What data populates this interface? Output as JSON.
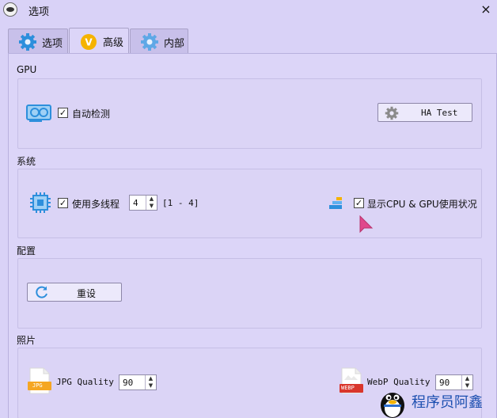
{
  "window": {
    "title": "选项",
    "close_glyph": "×"
  },
  "tabs": [
    {
      "label": "选项",
      "icon": "gear-icon",
      "active": false
    },
    {
      "label": "高级",
      "icon": "v-badge-icon",
      "active": true
    },
    {
      "label": "内部",
      "icon": "gear-icon",
      "active": false
    }
  ],
  "gpu": {
    "section_title": "GPU",
    "auto_detect_label": "自动检测",
    "auto_detect_checked": true,
    "ha_test_label": "HA Test"
  },
  "system": {
    "section_title": "系统",
    "multithread_label": "使用多线程",
    "multithread_checked": true,
    "thread_value": "4",
    "thread_range": "[1 - 4]",
    "show_usage_label": "显示CPU & GPU使用状况",
    "show_usage_checked": true
  },
  "config": {
    "section_title": "配置",
    "reset_label": "重设"
  },
  "photo": {
    "section_title": "照片",
    "jpg_label": "JPG Quality",
    "jpg_value": "90",
    "jpg_icon_text": "JPG",
    "webp_label": "WebP Quality",
    "webp_value": "90",
    "webp_icon_text": "WEBP"
  },
  "watermark": {
    "text": "程序员阿鑫"
  },
  "colors": {
    "background": "#d9d2f7",
    "panel": "#dcd5f8",
    "accent_blue": "#2d8fdc",
    "badge_orange": "#f5b300",
    "cursor_pink": "#e0488c"
  }
}
